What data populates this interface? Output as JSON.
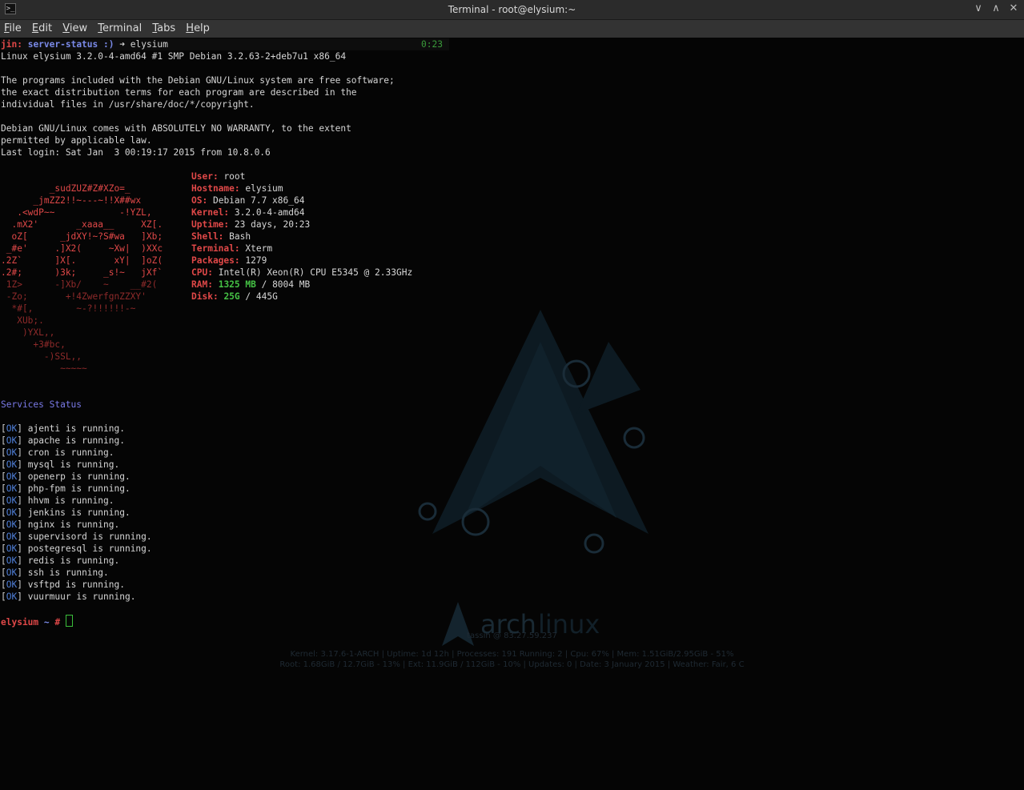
{
  "window": {
    "title": "Terminal - root@elysium:~",
    "app_icon": "terminal-icon"
  },
  "controls": {
    "minimize": "∨",
    "maximize": "∧",
    "close": "✕"
  },
  "menu": [
    {
      "u": "F",
      "rest": "ile"
    },
    {
      "u": "E",
      "rest": "dit"
    },
    {
      "u": "V",
      "rest": "iew"
    },
    {
      "u": "T",
      "rest": "erminal"
    },
    {
      "u": "T",
      "rest": "abs"
    },
    {
      "u": "H",
      "rest": "elp"
    }
  ],
  "prompt1": {
    "user": "jin:",
    "dir": "server-status :)",
    "arrow": "➜",
    "cmd": "elysium",
    "timer": "0:23"
  },
  "uname": "Linux elysium 3.2.0-4-amd64 #1 SMP Debian 3.2.63-2+deb7u1 x86_64",
  "motd": [
    "The programs included with the Debian GNU/Linux system are free software;",
    "the exact distribution terms for each program are described in the",
    "individual files in /usr/share/doc/*/copyright.",
    "",
    "Debian GNU/Linux comes with ABSOLUTELY NO WARRANTY, to the extent",
    "permitted by applicable law.",
    "Last login: Sat Jan  3 00:19:17 2015 from 10.8.0.6"
  ],
  "logo": [
    "",
    "         _sudZUZ#Z#XZo=_",
    "      _jmZZ2!!~---~!!X##wx",
    "   .<wdP~~            -!YZL,",
    "  .mX2'       _xaaa__     XZ[.",
    "  oZ[      _jdXY!~?S#wa   ]Xb;",
    " _#e'     .]X2(     ~Xw|  )XXc",
    ".2Z`      ]X[.       xY|  ]oZ(",
    ".2#;      )3k;     _s!~   jXf`",
    " 1Z>      -]Xb/    ~    __#2(",
    " -Zo;       +!4ZwerfgnZZXY'",
    "  *#[,        ~-?!!!!!!-~",
    "   XUb;.",
    "    )YXL,,",
    "      +3#bc,",
    "        -)SSL,,",
    "           ~~~~~"
  ],
  "sysinfo": [
    {
      "label": "User:",
      "value": "root"
    },
    {
      "label": "Hostname:",
      "value": "elysium"
    },
    {
      "label": "OS:",
      "value": "Debian 7.7 x86_64"
    },
    {
      "label": "Kernel:",
      "value": "3.2.0-4-amd64"
    },
    {
      "label": "Uptime:",
      "value": "23 days, 20:23"
    },
    {
      "label": "Shell:",
      "value": "Bash"
    },
    {
      "label": "Terminal:",
      "value": "Xterm"
    },
    {
      "label": "Packages:",
      "value": "1279"
    },
    {
      "label": "CPU:",
      "value": "Intel(R) Xeon(R) CPU E5345 @ 2.33GHz"
    },
    {
      "label": "RAM:",
      "hi": "1325 MB",
      "rest": " / 8004 MB"
    },
    {
      "label": "Disk:",
      "hi": "25G",
      "rest": " / 445G"
    }
  ],
  "services_title": "Services Status",
  "ok_label": "OK",
  "services": [
    "ajenti is running.",
    "apache is running.",
    "cron is running.",
    "mysql is running.",
    "openerp is running.",
    "php-fpm is running.",
    "hhvm is running.",
    "jenkins is running.",
    "nginx is running.",
    "supervisord is running.",
    "postegresql is running.",
    "redis is running.",
    "ssh is running.",
    "vsftpd is running.",
    "vuurmuur is running."
  ],
  "prompt2": {
    "host": "elysium",
    "dir": "~",
    "sym": "#"
  },
  "wallpaper": {
    "logo_text_a": "arch",
    "logo_text_b": "linux",
    "ip": "tassin @ 83.27.59.237",
    "line1": "Kernel: 3.17.6-1-ARCH  |  Uptime: 1d 12h  |  Processes: 191  Running: 2  |  Cpu: 67%                |  Mem: 1.51GiB/2.95GiB - 51%",
    "line2": "Root: 1.68GiB / 12.7GiB - 13%  |  Ext: 11.9GiB / 112GiB - 10%  |  Updates: 0  |  Date: 3 January 2015  |  Weather: Fair, 6 C"
  }
}
